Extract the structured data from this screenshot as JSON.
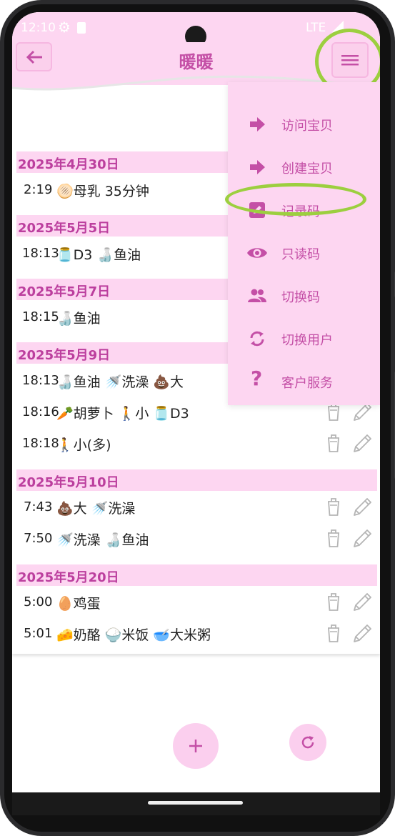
{
  "status_bar": {
    "time": "12:10",
    "network": "LTE"
  },
  "header": {
    "title": "暖暖"
  },
  "menu": {
    "items": [
      {
        "label": "访问宝贝",
        "icon": "arrow-right-icon"
      },
      {
        "label": "创建宝贝",
        "icon": "arrow-right-icon"
      },
      {
        "label": "记录码",
        "icon": "edit-icon"
      },
      {
        "label": "只读码",
        "icon": "eye-icon"
      },
      {
        "label": "切换码",
        "icon": "people-icon"
      },
      {
        "label": "切换用户",
        "icon": "sync-icon"
      },
      {
        "label": "客户服务",
        "icon": "question-icon"
      }
    ]
  },
  "days": [
    {
      "date": "2025年4月30日",
      "entries": [
        {
          "time": "2:19",
          "text": "🫓母乳 35分钟"
        }
      ]
    },
    {
      "date": "2025年5月5日",
      "entries": [
        {
          "time": "18:13",
          "text": "🫙D3 🍶鱼油"
        }
      ]
    },
    {
      "date": "2025年5月7日",
      "entries": [
        {
          "time": "18:15",
          "text": "🍶鱼油"
        }
      ]
    },
    {
      "date": "2025年5月9日",
      "entries": [
        {
          "time": "18:13",
          "text": "🍶鱼油 🚿洗澡 💩大"
        },
        {
          "time": "18:16",
          "text": "🥕胡萝卜 🚶小 🫙D3"
        },
        {
          "time": "18:18",
          "text": "🚶小(多)"
        }
      ]
    },
    {
      "date": "2025年5月10日",
      "entries": [
        {
          "time": "7:43",
          "text": "💩大 🚿洗澡"
        },
        {
          "time": "7:50",
          "text": "🚿洗澡 🍶鱼油"
        }
      ]
    },
    {
      "date": "2025年5月20日",
      "entries": [
        {
          "time": "5:00",
          "text": "🥚鸡蛋"
        },
        {
          "time": "5:01",
          "text": "🧀奶酪 🍚米饭 🥣大米粥"
        }
      ]
    }
  ],
  "colors": {
    "accent": "#c44fa6",
    "header_bg": "#fdd6f1",
    "annotation": "#9ccf3f"
  }
}
